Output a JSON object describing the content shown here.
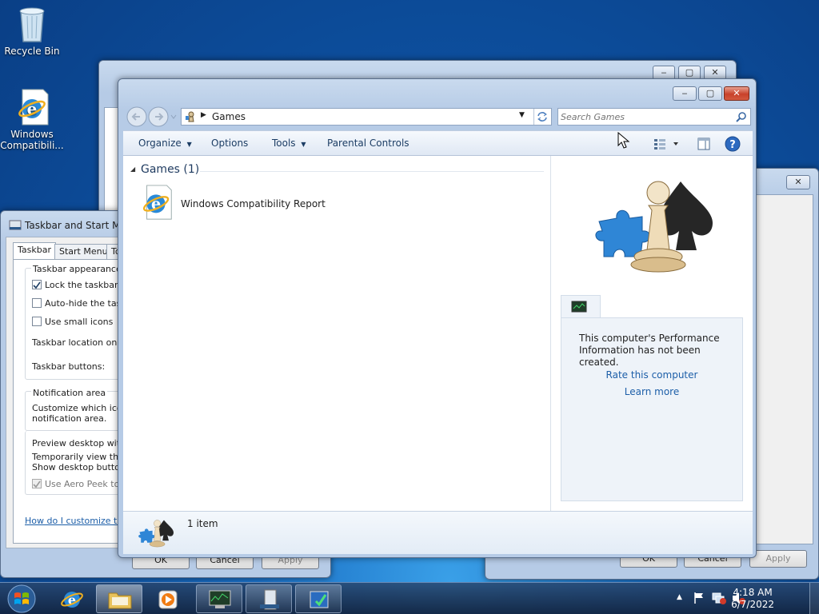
{
  "desktop": {
    "icons": [
      {
        "label": "Recycle Bin"
      },
      {
        "label": "Windows Compatibili..."
      }
    ]
  },
  "explorer": {
    "address": {
      "segment": "Games"
    },
    "search": {
      "placeholder": "Search Games"
    },
    "toolbar": {
      "organize": "Organize",
      "options": "Options",
      "tools": "Tools",
      "parental": "Parental Controls"
    },
    "group": {
      "header": "Games (1)"
    },
    "items": [
      {
        "label": "Windows Compatibility Report"
      }
    ],
    "panel": {
      "message": "This computer's Performance Information has not been created.",
      "rate_link": "Rate this computer",
      "learn_link": "Learn more"
    },
    "details": {
      "count": "1 item"
    }
  },
  "taskbar_props": {
    "title": "Taskbar and Start Menu",
    "tabs": [
      "Taskbar",
      "Start Menu",
      "To"
    ],
    "appearance_group": "Taskbar appearance",
    "lock": "Lock the taskbar",
    "autohide": "Auto-hide the taskb",
    "small_icons": "Use small icons",
    "location": "Taskbar location on scr",
    "buttons_label": "Taskbar buttons:",
    "notif_group": "Notification area",
    "notif_text1": "Customize which icons",
    "notif_text2": "notification area.",
    "preview_title": "Preview desktop with A",
    "preview_text1": "Temporarily view the d",
    "preview_text2": "Show desktop button a",
    "aero_peek": "Use Aero Peek to p",
    "help_link": "How do I customize the t",
    "ok": "OK",
    "cancel": "Cancel",
    "apply": "Apply"
  },
  "right_dialog": {
    "ok": "OK",
    "cancel": "Cancel",
    "apply": "Apply"
  },
  "tray": {
    "time": "4:18 AM",
    "date": "6/7/2022"
  },
  "colors": {
    "accent": "#1c5ea8",
    "close": "#c8412a"
  }
}
